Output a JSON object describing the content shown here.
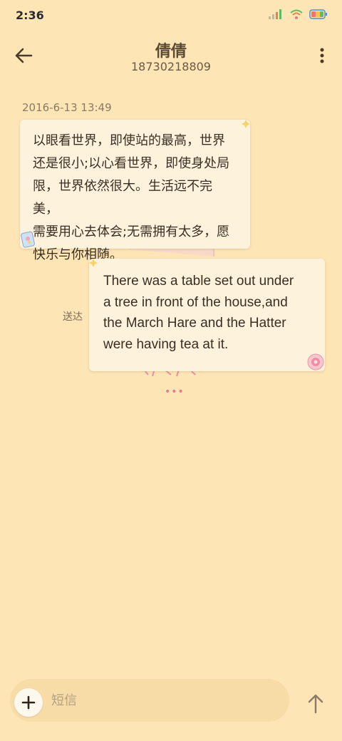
{
  "status_bar": {
    "time": "2:36",
    "icons": [
      "signal-icon",
      "wifi-icon",
      "battery-icon"
    ]
  },
  "header": {
    "contact_name": "倩倩",
    "phone_number": "18730218809",
    "back_icon": "arrow-left-icon",
    "more_icon": "more-vertical-icon"
  },
  "conversation": {
    "timestamp": "2016-6-13 13:49",
    "messages": [
      {
        "direction": "incoming",
        "lines": [
          "以眼看世界，即使站的最高，世界",
          "还是很小;以心看世界，即使身处局",
          "限，世界依然很大。生活远不完美，",
          "需要用心去体会;无需拥有太多，愿",
          "快乐与你相随。"
        ]
      },
      {
        "direction": "outgoing",
        "status": "送达",
        "lines": [
          "There was a table set out under",
          "a tree in front of the house,and",
          "the March Hare and the Hatter",
          "were having tea at it."
        ]
      }
    ],
    "more_dots": "•••"
  },
  "composer": {
    "placeholder": "短信",
    "value": "",
    "add_icon": "plus-icon",
    "send_icon": "arrow-up-icon"
  },
  "colors": {
    "background": "#fde5b5",
    "bubble": "#fdf3dd",
    "input_bar": "#f7dca7",
    "text": "#3a2e22"
  }
}
